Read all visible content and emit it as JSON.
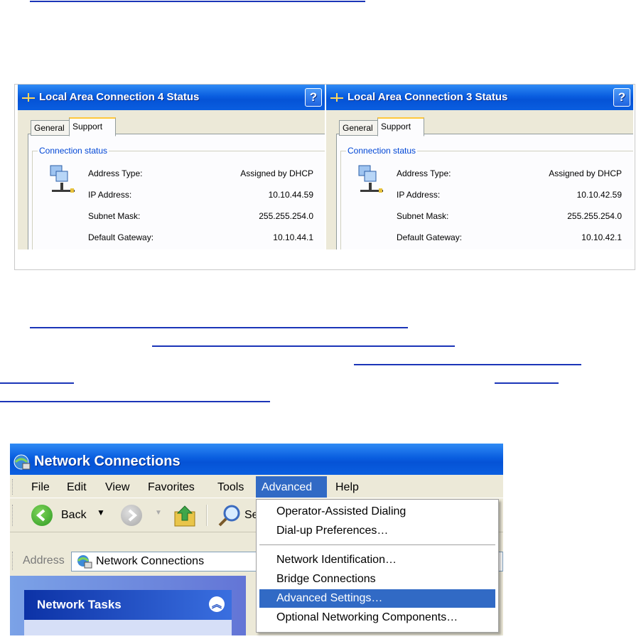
{
  "status_windows": [
    {
      "title": "Local Area Connection 4 Status",
      "tabs": [
        "General",
        "Support"
      ],
      "group_label": "Connection status",
      "rows": [
        {
          "label": "Address Type:",
          "value": "Assigned by DHCP"
        },
        {
          "label": "IP Address:",
          "value": "10.10.44.59"
        },
        {
          "label": "Subnet Mask:",
          "value": "255.255.254.0"
        },
        {
          "label": "Default Gateway:",
          "value": "10.10.44.1"
        }
      ]
    },
    {
      "title": "Local Area Connection 3 Status",
      "tabs": [
        "General",
        "Support"
      ],
      "group_label": "Connection status",
      "rows": [
        {
          "label": "Address Type:",
          "value": "Assigned by DHCP"
        },
        {
          "label": "IP Address:",
          "value": "10.10.42.59"
        },
        {
          "label": "Subnet Mask:",
          "value": "255.255.254.0"
        },
        {
          "label": "Default Gateway:",
          "value": "10.10.42.1"
        }
      ]
    }
  ],
  "network_connections": {
    "title": "Network Connections",
    "menu": [
      "File",
      "Edit",
      "View",
      "Favorites",
      "Tools",
      "Advanced",
      "Help"
    ],
    "toolbar": {
      "back_label": "Back",
      "search_label": "Se"
    },
    "address": {
      "label": "Address",
      "value": "Network Connections"
    },
    "network_tasks": {
      "title": "Network Tasks"
    }
  },
  "advanced_menu": {
    "items": [
      "Operator-Assisted Dialing",
      "Dial-up Preferences…",
      "Network Identification…",
      "Bridge Connections",
      "Advanced Settings…",
      "Optional Networking Components…"
    ],
    "highlighted": "Advanced Settings…"
  },
  "colors": {
    "xp_titlebar": "#0a5ee0",
    "menu_highlight": "#316ac5",
    "link_underline": "#1b35b8"
  }
}
